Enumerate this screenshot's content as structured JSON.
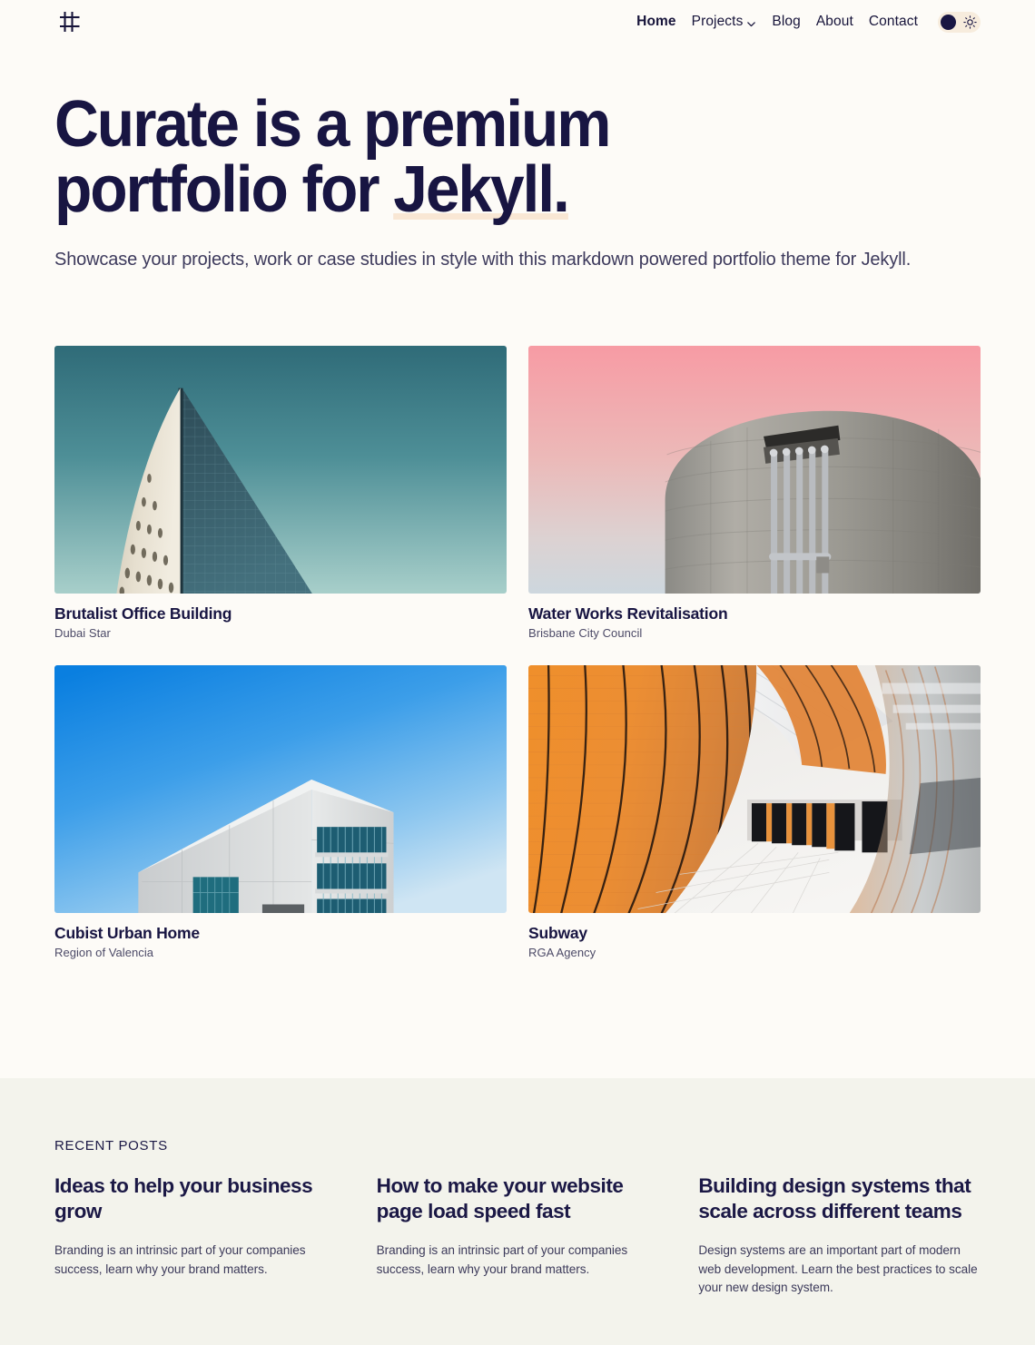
{
  "header": {
    "logo_name": "curate-logo",
    "nav": [
      {
        "label": "Home",
        "active": true,
        "has_chevron": false
      },
      {
        "label": "Projects",
        "active": false,
        "has_chevron": true
      },
      {
        "label": "Blog",
        "active": false,
        "has_chevron": false
      },
      {
        "label": "About",
        "active": false,
        "has_chevron": false
      },
      {
        "label": "Contact",
        "active": false,
        "has_chevron": false
      }
    ],
    "theme_toggle": {
      "moon_icon": "moon-circle-icon",
      "sun_icon": "sun-icon",
      "state": "light"
    }
  },
  "hero": {
    "title_line1": "Curate is a premium",
    "title_line2_before": "portfolio for ",
    "title_highlight": "Jekyll.",
    "highlight_color": "#f9e7d4",
    "subtitle": "Showcase your projects, work or case studies in style with this markdown powered portfolio theme for Jekyll."
  },
  "projects": [
    {
      "title": "Brutalist Office Building",
      "client": "Dubai Star",
      "image_alt": "Triangular glass and concrete tower against a teal gradient sky"
    },
    {
      "title": "Water Works Revitalisation",
      "client": "Brisbane City Council",
      "image_alt": "Concrete cylindrical water tank with pipes against a pink gradient sky"
    },
    {
      "title": "Cubist Urban Home",
      "client": "Region of Valencia",
      "image_alt": "Angular white concrete building with teal windows against a blue sky"
    },
    {
      "title": "Subway",
      "client": "RGA Agency",
      "image_alt": "Orange panelled subway tunnel with white tiled floor"
    }
  ],
  "recent_posts": {
    "label": "RECENT POSTS",
    "items": [
      {
        "title": "Ideas to help your business grow",
        "excerpt": "Branding is an intrinsic part of your companies success, learn why your brand matters."
      },
      {
        "title": "How to make your website page load speed fast",
        "excerpt": "Branding is an intrinsic part of your companies success, learn why your brand matters."
      },
      {
        "title": "Building design systems that scale across different teams",
        "excerpt": "Design systems are an important part of modern web development. Learn the best practices to scale your new design system."
      }
    ]
  },
  "theme": {
    "page_background": "#fdfbf7",
    "posts_background": "#f3f3ec",
    "text_dark": "#181542",
    "text_muted": "#3d3a5c",
    "accent_peach": "#f7ecdd"
  }
}
